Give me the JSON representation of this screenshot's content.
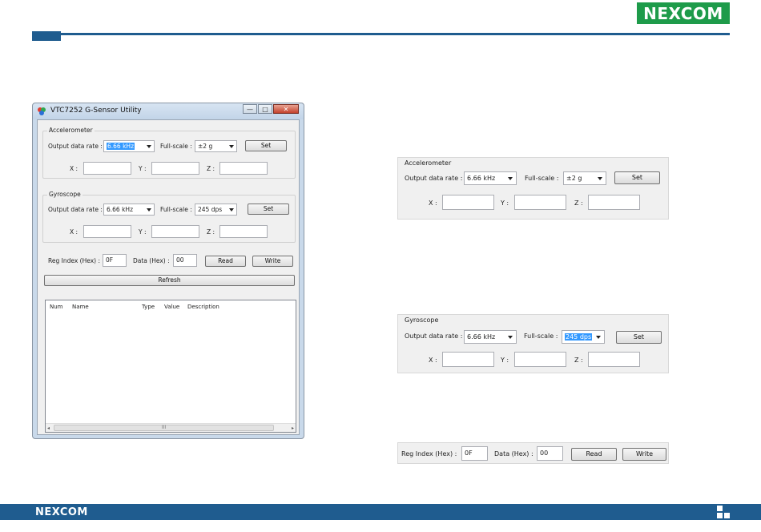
{
  "brand": {
    "logo_text": "NEXCOM",
    "footer_logo_text": "NEXCOM"
  },
  "window": {
    "title": "VTC7252 G-Sensor Utility",
    "minimize_glyph": "—",
    "maximize_glyph": "□",
    "close_glyph": "✕"
  },
  "accelerometer": {
    "group_label": "Accelerometer",
    "output_rate_label": "Output data rate :",
    "output_rate_value": "6.66 kHz",
    "full_scale_label": "Full-scale :",
    "full_scale_value": "±2 g",
    "set_label": "Set",
    "x_label": "X :",
    "y_label": "Y :",
    "z_label": "Z :",
    "x_value": "",
    "y_value": "",
    "z_value": ""
  },
  "gyroscope": {
    "group_label": "Gyroscope",
    "output_rate_label": "Output data rate :",
    "output_rate_value": "6.66 kHz",
    "full_scale_label": "Full-scale :",
    "full_scale_value": "245 dps",
    "set_label": "Set",
    "x_label": "X :",
    "y_label": "Y :",
    "z_label": "Z :",
    "x_value": "",
    "y_value": "",
    "z_value": ""
  },
  "register": {
    "reg_index_label": "Reg Index (Hex) :",
    "reg_index_value": "0F",
    "data_label": "Data (Hex) :",
    "data_value": "00",
    "read_label": "Read",
    "write_label": "Write"
  },
  "refresh_label": "Refresh",
  "table": {
    "columns": [
      "Num",
      "Name",
      "Type",
      "Value",
      "Description"
    ],
    "scroll_thumb_glyph": "III",
    "left_arrow": "◂",
    "right_arrow": "▸"
  },
  "colors": {
    "brand_blue": "#1f5c8f",
    "brand_green": "#1e9b4a",
    "selection": "#3399ff"
  }
}
